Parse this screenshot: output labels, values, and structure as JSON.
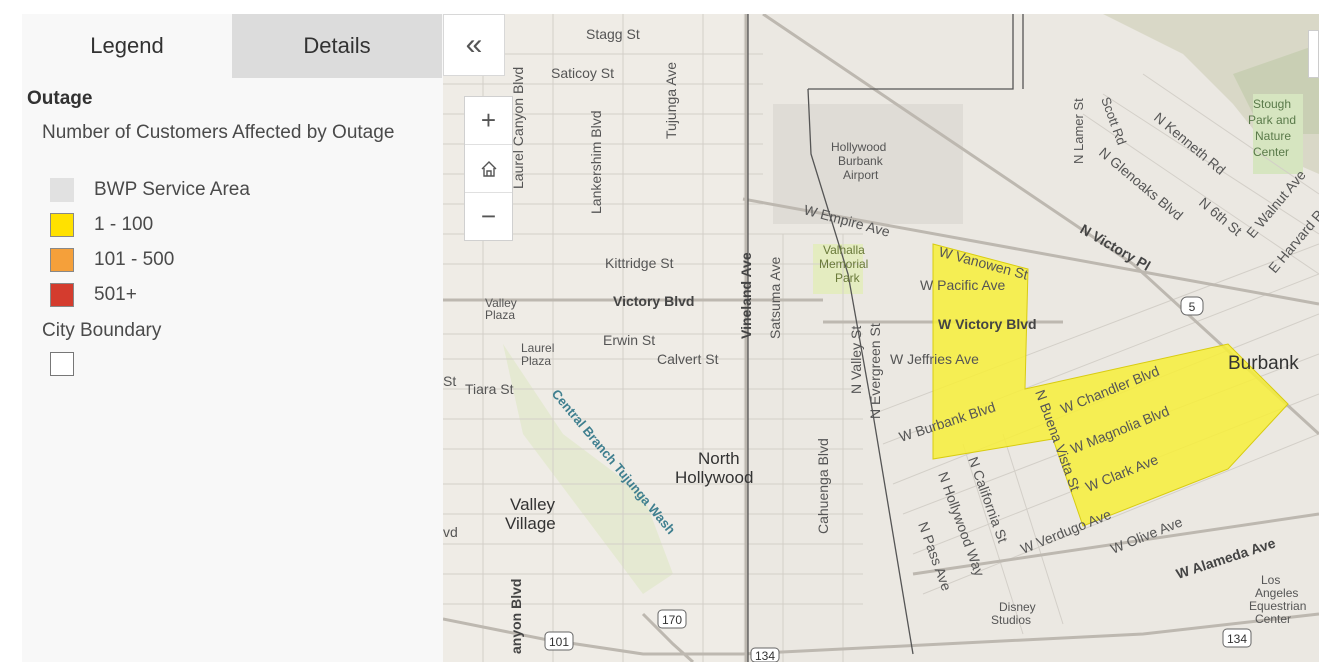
{
  "tabs": [
    {
      "label": "Legend",
      "active": true
    },
    {
      "label": "Details",
      "active": false
    }
  ],
  "legend": {
    "layer_title": "Outage",
    "field_title": "Number of Customers Affected by Outage",
    "items": [
      {
        "label": "BWP Service Area",
        "color": "#e1e1e1"
      },
      {
        "label": "1 - 100",
        "color": "#ffe100"
      },
      {
        "label": "101 - 500",
        "color": "#f5a03a"
      },
      {
        "label": "501+",
        "color": "#d43c2e"
      }
    ],
    "boundary_title": "City Boundary",
    "boundary_color": "#ffffff"
  },
  "icons": {
    "collapse": "double-chevron-left-icon",
    "zoom_in": "plus-icon",
    "home": "home-icon",
    "zoom_out": "minus-icon"
  },
  "map": {
    "outage_color": "#f7ee3a",
    "labels": {
      "stagg": "Stagg St",
      "saticoy": "Saticoy St",
      "laurel_canyon": "Laurel Canyon Blvd",
      "lankershim": "Lankershim Blvd",
      "tujunga": "Tujunga Ave",
      "airport1": "Hollywood",
      "airport2": "Burbank",
      "airport3": "Airport",
      "empire": "W Empire Ave",
      "valhalla1": "Valhalla",
      "valhalla2": "Memorial",
      "valhalla3": "Park",
      "vanowen": "W Vanowen St",
      "pacific": "W Pacific Ave",
      "kittridge": "Kittridge St",
      "vineland": "Vineland Ave",
      "satsuma": "Satsuma Ave",
      "victory": "Victory Blvd",
      "w_victory": "W Victory Blvd",
      "valley_plaza1": "Valley",
      "valley_plaza2": "Plaza",
      "erwin": "Erwin St",
      "calvert": "Calvert St",
      "laurel_plaza1": "Laurel",
      "laurel_plaza2": "Plaza",
      "n_valley": "N Valley St",
      "n_evergreen": "N Evergreen St",
      "jeffries": "W Jeffries Ave",
      "burbank": "Burbank",
      "tiara": "Tiara St",
      "central_branch": "Central Branch Tujunga Wash",
      "w_burbank": "W Burbank Blvd",
      "chandler": "W Chandler Blvd",
      "magnolia": "W Magnolia Blvd",
      "clark": "W Clark Ave",
      "buena_vista": "N Buena Vista St",
      "north_hollywood1": "North",
      "north_hollywood2": "Hollywood",
      "cahuenga": "Cahuenga Blvd",
      "california": "N California St",
      "hollywood_way": "N Hollywood Way",
      "pass": "N Pass Ave",
      "verdugo": "W Verdugo Ave",
      "olive": "W Olive Ave",
      "alameda": "W Alameda Ave",
      "valley_village1": "Valley",
      "valley_village2": "Village",
      "disney1": "Disney",
      "disney2": "Studios",
      "los_angeles1": "Los",
      "los_angeles2": "Angeles",
      "los_angeles3": "Equestrian",
      "los_angeles4": "Center",
      "n_victory_pl": "N Victory Pl",
      "n_lamer": "N Lamer St",
      "scott": "Scott Rd",
      "kenneth": "N Kenneth Rd",
      "glenoaks": "N Glenoaks Blvd",
      "sixth": "N 6th St",
      "walnut": "E Walnut Ave",
      "harvard": "E Harvard Rd",
      "stough1": "Stough",
      "stough2": "Park and",
      "stough3": "Nature",
      "stough4": "Center",
      "hwy5": "5",
      "hwy170": "170",
      "hwy101": "101",
      "hwy134a": "134",
      "hwy134b": "134",
      "canyon_blvd": "anyon Blvd",
      "st_left": "St",
      "vd_left": "vd"
    }
  }
}
